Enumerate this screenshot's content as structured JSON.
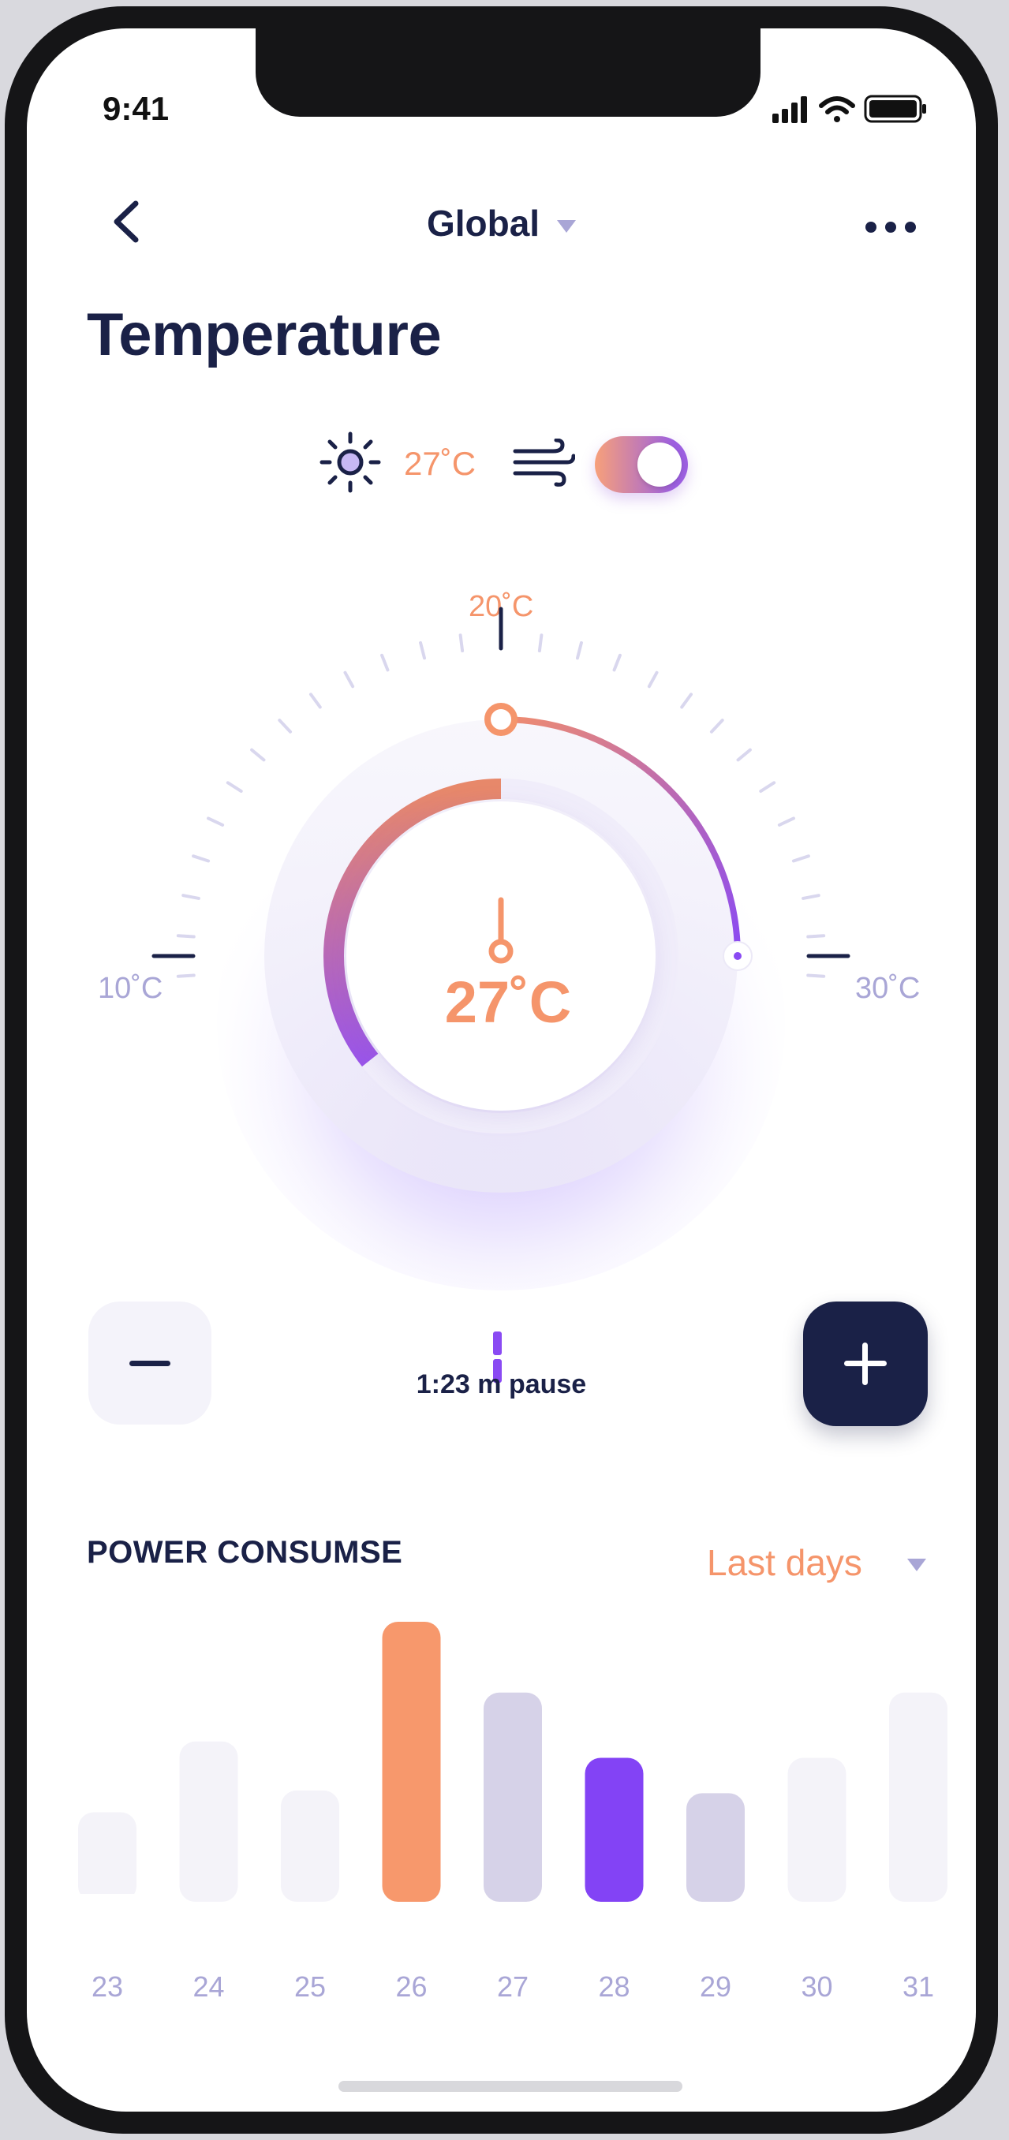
{
  "status_bar": {
    "time": "9:41"
  },
  "nav": {
    "title": "Global"
  },
  "page": {
    "title": "Temperature"
  },
  "mode": {
    "temperature": "27˚C",
    "ac_on": true
  },
  "dial": {
    "min_label": "10˚C",
    "mid_label": "20˚C",
    "max_label": "30˚C",
    "current_label": "27˚C",
    "min": 10,
    "max": 30,
    "current": 27,
    "colors": {
      "accent": "#f5956b",
      "purple": "#8a4af3",
      "tick": "#d9d7ee"
    }
  },
  "controls": {
    "pause_text": "1:23 m pause"
  },
  "power": {
    "title": "POWER CONSUMSE",
    "filter": "Last days"
  },
  "chart_data": {
    "type": "bar",
    "categories": [
      "23",
      "24",
      "25",
      "26",
      "27",
      "28",
      "29",
      "30",
      "31"
    ],
    "values": [
      30,
      56,
      38,
      100,
      74,
      50,
      37,
      50,
      74
    ],
    "highlight": {
      "26": "#f7986c",
      "28": "#8343f5"
    },
    "colors": {
      "default": "#f4f3f9",
      "muted": "#d6d2e8"
    },
    "muted_categories": [
      "27",
      "29"
    ],
    "ylim": [
      0,
      100
    ]
  }
}
